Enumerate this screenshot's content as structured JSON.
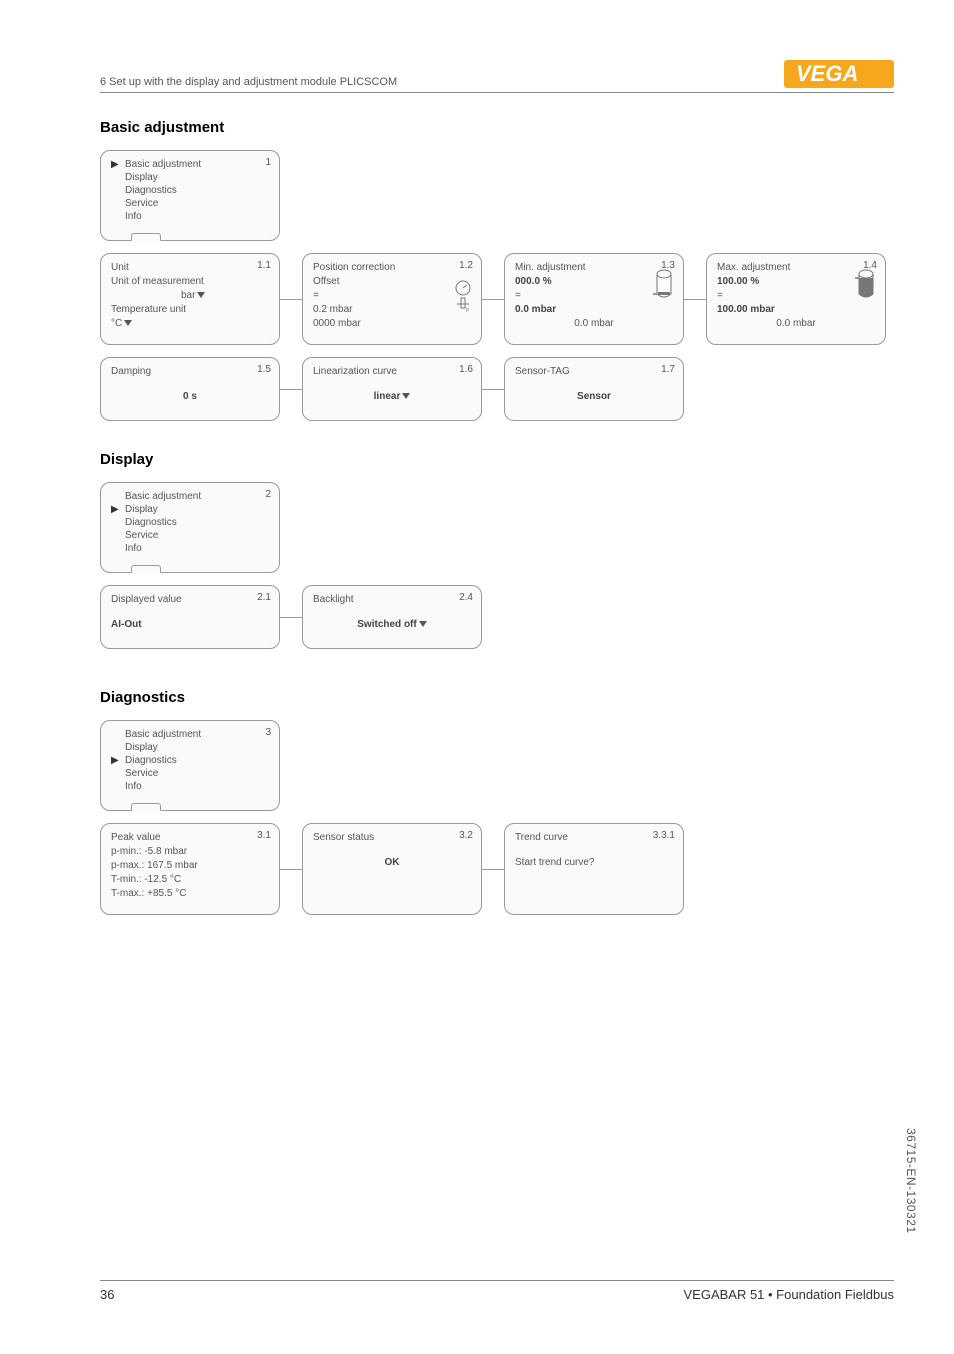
{
  "header": {
    "breadcrumb": "6 Set up with the display and adjustment module PLICSCOM",
    "logo_text": "VEGA"
  },
  "sections": {
    "basic_adjustment": {
      "title": "Basic adjustment",
      "menu": {
        "num": "1",
        "items": [
          "Basic adjustment",
          "Display",
          "Diagnostics",
          "Service",
          "Info"
        ],
        "selected_index": 0
      },
      "cards": {
        "unit": {
          "num": "1.1",
          "title": "Unit",
          "l2": "Unit of measurement",
          "l3": "bar",
          "l4": "Temperature unit",
          "l5": "°C"
        },
        "position": {
          "num": "1.2",
          "title": "Position correction",
          "l2": "Offset",
          "l3": "=",
          "l4": "0.2 mbar",
          "l5": "0000 mbar"
        },
        "min": {
          "num": "1.3",
          "title": "Min. adjustment",
          "l2": "000.0 %",
          "l3": "=",
          "l4": "0.0 mbar",
          "l5": "0.0 mbar"
        },
        "max": {
          "num": "1.4",
          "title": "Max. adjustment",
          "l2": "100.00 %",
          "l3": "=",
          "l4": "100.00 mbar",
          "l5": "0.0 mbar"
        },
        "damping": {
          "num": "1.5",
          "title": "Damping",
          "value": "0 s"
        },
        "linearization": {
          "num": "1.6",
          "title": "Linearization curve",
          "value": "linear"
        },
        "sensortag": {
          "num": "1.7",
          "title": "Sensor-TAG",
          "value": "Sensor"
        }
      }
    },
    "display": {
      "title": "Display",
      "menu": {
        "num": "2",
        "items": [
          "Basic adjustment",
          "Display",
          "Diagnostics",
          "Service",
          "Info"
        ],
        "selected_index": 1
      },
      "cards": {
        "displayed_value": {
          "num": "2.1",
          "title": "Displayed value",
          "value": "AI-Out"
        },
        "backlight": {
          "num": "2.4",
          "title": "Backlight",
          "value": "Switched off"
        }
      }
    },
    "diagnostics": {
      "title": "Diagnostics",
      "menu": {
        "num": "3",
        "items": [
          "Basic adjustment",
          "Display",
          "Diagnostics",
          "Service",
          "Info"
        ],
        "selected_index": 2
      },
      "cards": {
        "peak": {
          "num": "3.1",
          "title": "Peak value",
          "l2": "p-min.: -5.8 mbar",
          "l3": "p-max.: 167.5 mbar",
          "l4": "T-min.: -12.5 °C",
          "l5": "T-max.: +85.5 °C"
        },
        "status": {
          "num": "3.2",
          "title": "Sensor status",
          "value": "OK"
        },
        "trend": {
          "num": "3.3.1",
          "title": "Trend curve",
          "value": "Start trend curve?"
        }
      }
    }
  },
  "footer": {
    "page_number": "36",
    "product": "VEGABAR 51 • Foundation Fieldbus"
  },
  "side_code": "36715-EN-130321"
}
